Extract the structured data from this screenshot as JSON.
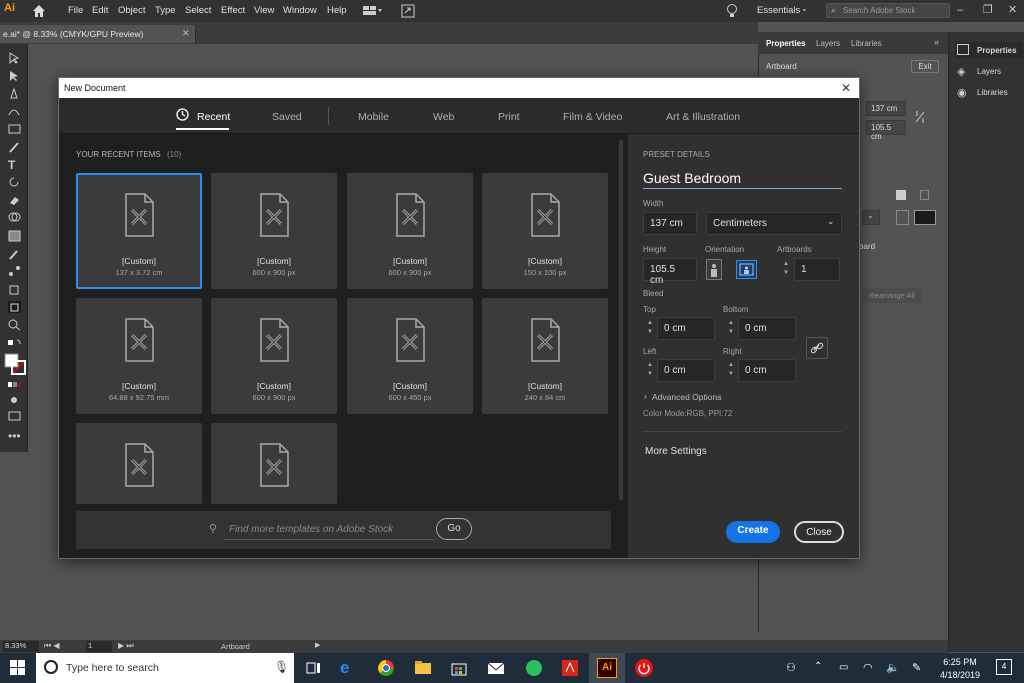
{
  "app": {
    "logo": "Ai"
  },
  "menu": [
    "File",
    "Edit",
    "Object",
    "Type",
    "Select",
    "Effect",
    "View",
    "Window",
    "Help"
  ],
  "menubar_right": {
    "workspace": "Essentials",
    "search_placeholder": "Search Adobe Stock"
  },
  "document_tab": "e.ai* @ 8.33% (CMYK/GPU Preview)",
  "props_panel": {
    "tabs": [
      "Properties",
      "Layers",
      "Libraries"
    ],
    "section": "Artboard",
    "exit_label": "Exit",
    "width_value": "137 cm",
    "height_value": "105.5 cm",
    "artboard_text": "oard",
    "rearrange_label": "Rearrange All"
  },
  "side_dock": [
    "Properties",
    "Layers",
    "Libraries"
  ],
  "status": {
    "zoom": "8.33%",
    "page": "1",
    "mode": "Artboard"
  },
  "dialog": {
    "title": "New Document",
    "tabs": [
      "Recent",
      "Saved",
      "Mobile",
      "Web",
      "Print",
      "Film & Video",
      "Art & Illustration"
    ],
    "active_tab": "Recent",
    "recent_heading": "YOUR RECENT ITEMS",
    "recent_count": "(10)",
    "items": [
      {
        "name": "[Custom]",
        "size": "137 x 3.72 cm"
      },
      {
        "name": "[Custom]",
        "size": "600 x 900 px"
      },
      {
        "name": "[Custom]",
        "size": "600 x 900 px"
      },
      {
        "name": "[Custom]",
        "size": "150 x 100 px"
      },
      {
        "name": "[Custom]",
        "size": "64.88 x 92.75 mm"
      },
      {
        "name": "[Custom]",
        "size": "600 x 900 px"
      },
      {
        "name": "[Custom]",
        "size": "600 x 450 px"
      },
      {
        "name": "[Custom]",
        "size": "240 x 84 cm"
      },
      {
        "name": "",
        "size": ""
      },
      {
        "name": "",
        "size": ""
      }
    ],
    "template_search_placeholder": "Find more templates on Adobe Stock",
    "go_label": "Go",
    "preset": {
      "heading": "PRESET DETAILS",
      "name": "Guest Bedroom",
      "width_label": "Width",
      "width": "137 cm",
      "units": "Centimeters",
      "height_label": "Height",
      "height": "105.5 cm",
      "orientation_label": "Orientation",
      "artboards_label": "Artboards",
      "artboards": "1",
      "bleed_label": "Bleed",
      "top_label": "Top",
      "bottom_label": "Bottom",
      "left_label": "Left",
      "right_label": "Right",
      "top": "0 cm",
      "bottom": "0 cm",
      "left": "0 cm",
      "right": "0 cm",
      "advanced_label": "Advanced Options",
      "color_mode": "Color Mode:RGB, PPI:72",
      "more_settings": "More Settings",
      "create_label": "Create",
      "close_label": "Close"
    }
  },
  "taskbar": {
    "search_placeholder": "Type here to search",
    "time": "6:25 PM",
    "date": "4/18/2019",
    "notifications": "4"
  },
  "colors": {
    "accent": "#1473e6",
    "dialog_bg": "#1f1f1f",
    "card_bg": "#3b3b3b",
    "ai_orange": "#ff9a00"
  }
}
